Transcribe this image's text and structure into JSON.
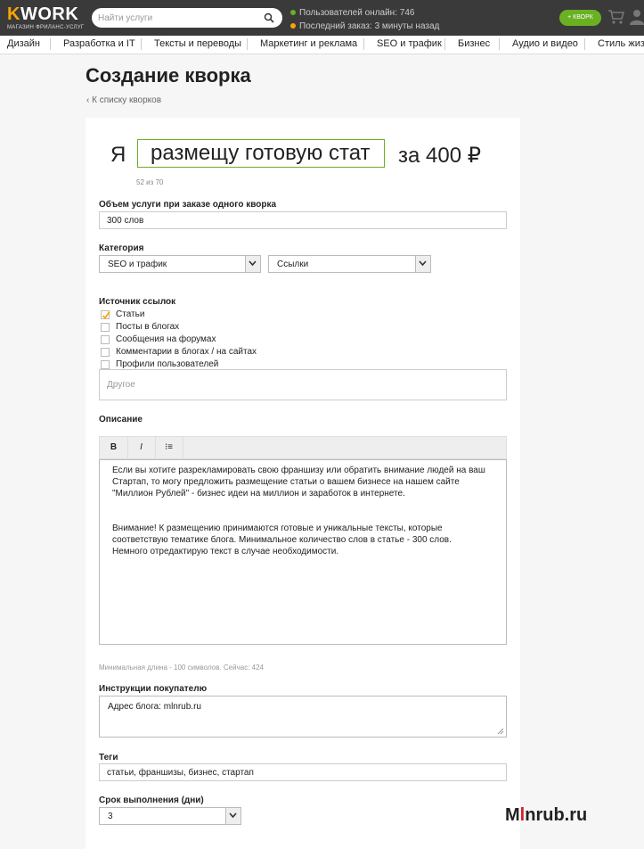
{
  "header": {
    "logo_k": "K",
    "logo_rest": "WORK",
    "logo_sub": "МАГАЗИН ФРИЛАНС-УСЛУГ",
    "search_placeholder": "Найти услуги",
    "users_online": "Пользователей онлайн: 746",
    "last_order": "Последний заказ: 3 минуты назад",
    "add_button": "+ КВОРК",
    "icons": [
      "search-icon",
      "cart-icon",
      "user-icon"
    ]
  },
  "categories": [
    "Дизайн",
    "Разработка и IT",
    "Тексты и переводы",
    "Маркетинг и реклама",
    "SEO и трафик",
    "Бизнес",
    "Аудио и видео",
    "Стиль жизни"
  ],
  "page": {
    "title": "Создание кворка",
    "back_link": "К списку кворков"
  },
  "kwork": {
    "prefix": "Я",
    "title_value": "размещу готовую статью",
    "suffix": "за 400 ₽",
    "char_count": "52 из 70"
  },
  "volume": {
    "label": "Объем услуги при заказе одного кворка",
    "value": "300 слов"
  },
  "category": {
    "label": "Категория",
    "main": "SEO и трафик",
    "sub": "Ссылки"
  },
  "link_source": {
    "label": "Источник ссылок",
    "options": [
      {
        "label": "Статьи",
        "checked": true
      },
      {
        "label": "Посты в блогах",
        "checked": false
      },
      {
        "label": "Сообщения на форумах",
        "checked": false
      },
      {
        "label": "Комментарии в блогах / на сайтах",
        "checked": false
      },
      {
        "label": "Профили пользователей",
        "checked": false
      }
    ],
    "other_placeholder": "Другое"
  },
  "description": {
    "label": "Описание",
    "toolbar": {
      "bold": "B",
      "italic": "I",
      "list": "⁝≡"
    },
    "paragraph1": "Если вы хотите разрекламировать свою франшизу или обратить внимание людей на ваш Стартап, то могу предложить размещение статьи о вашем бизнесе на нашем сайте \"Миллион Рублей\" - бизнес идеи на миллион и заработок в интернете.",
    "paragraph2": "Внимание! К размещению принимаются готовые и уникальные тексты, которые соответствую тематике блога. Минимальное количество слов в статье - 300 слов. Немного отредактирую текст в случае необходимости.",
    "hint": "Минимальная длина - 100 символов. Сейчас: 424"
  },
  "instructions": {
    "label": "Инструкции покупателю",
    "value": "Адрес блога: mlnrub.ru"
  },
  "tags": {
    "label": "Теги",
    "value": "статьи, франшизы, бизнес, стартап"
  },
  "deadline": {
    "label": "Срок выполнения (дни)",
    "value": "3"
  },
  "watermark": {
    "part1": "M",
    "part2": "l",
    "part3": "nrub.ru"
  },
  "colors": {
    "accent_green": "#6ab023",
    "logo_orange": "#f7a700",
    "topbar": "#3a3a3a",
    "watermark_red": "#d71f2a"
  }
}
